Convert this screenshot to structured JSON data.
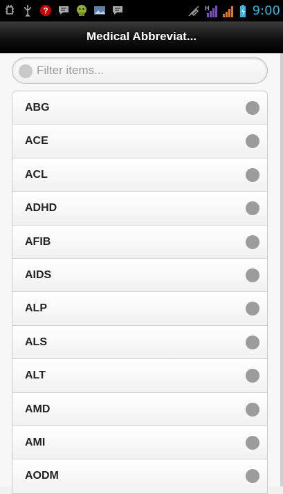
{
  "status_bar": {
    "time": "9:00",
    "network_label": "H",
    "time_color": "#33b5e5",
    "left_icons": [
      "usb-debug-icon",
      "usb-icon",
      "question-icon",
      "message-icon",
      "android-icon",
      "image-icon",
      "message-icon-2"
    ],
    "right_icons": [
      "mute-icon",
      "signal-h-icon",
      "wifi-signal-icon",
      "battery-charging-icon"
    ]
  },
  "header": {
    "title": "Medical Abbreviat..."
  },
  "filter": {
    "placeholder": "Filter items..."
  },
  "list": {
    "items": [
      {
        "label": "ABG"
      },
      {
        "label": "ACE"
      },
      {
        "label": "ACL"
      },
      {
        "label": "ADHD"
      },
      {
        "label": "AFIB"
      },
      {
        "label": "AIDS"
      },
      {
        "label": "ALP"
      },
      {
        "label": "ALS"
      },
      {
        "label": "ALT"
      },
      {
        "label": "AMD"
      },
      {
        "label": "AMI"
      },
      {
        "label": "AODM"
      }
    ]
  }
}
